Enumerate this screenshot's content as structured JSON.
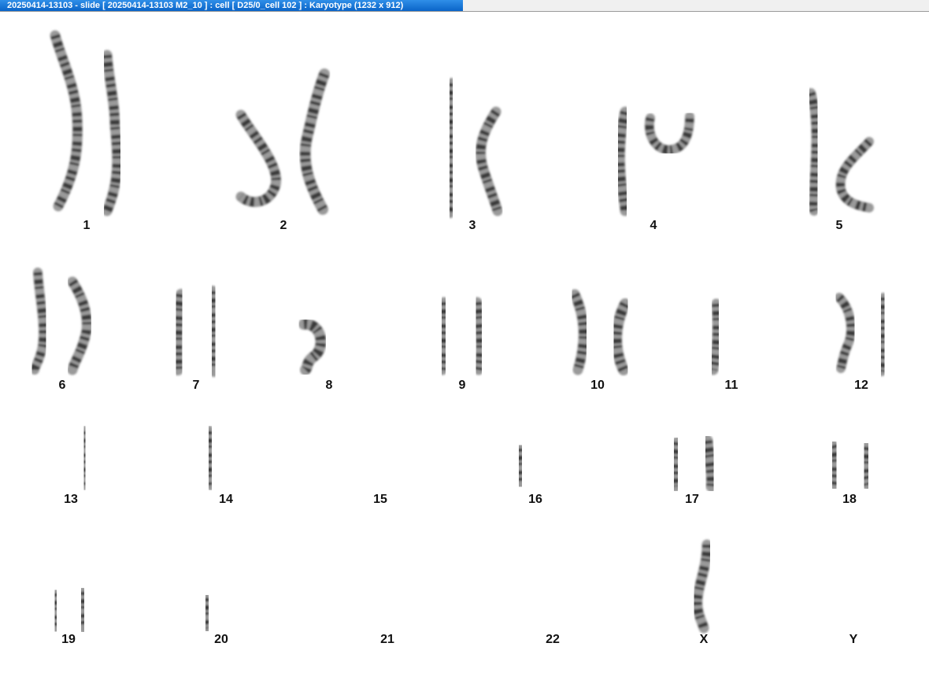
{
  "window": {
    "title": "20250414-13103 - slide [ 20250414-13103 M2_10 ] : cell [ D25/0_cell 102 ] : Karyotype  (1232 x 912)"
  },
  "colors": {
    "title_tab": "#0a64c8",
    "background": "#ffffff",
    "chromosome_dark": "#2a2a2a",
    "chromosome_light": "#9a9a9a"
  },
  "karyotype": {
    "groups": [
      {
        "label": "1"
      },
      {
        "label": "2"
      },
      {
        "label": "3"
      },
      {
        "label": "4"
      },
      {
        "label": "5"
      },
      {
        "label": "6"
      },
      {
        "label": "7"
      },
      {
        "label": "8"
      },
      {
        "label": "9"
      },
      {
        "label": "10"
      },
      {
        "label": "11"
      },
      {
        "label": "12"
      },
      {
        "label": "13"
      },
      {
        "label": "14"
      },
      {
        "label": "15"
      },
      {
        "label": "16"
      },
      {
        "label": "17"
      },
      {
        "label": "18"
      },
      {
        "label": "19"
      },
      {
        "label": "20"
      },
      {
        "label": "21"
      },
      {
        "label": "22"
      },
      {
        "label": "X"
      },
      {
        "label": "Y"
      }
    ]
  }
}
